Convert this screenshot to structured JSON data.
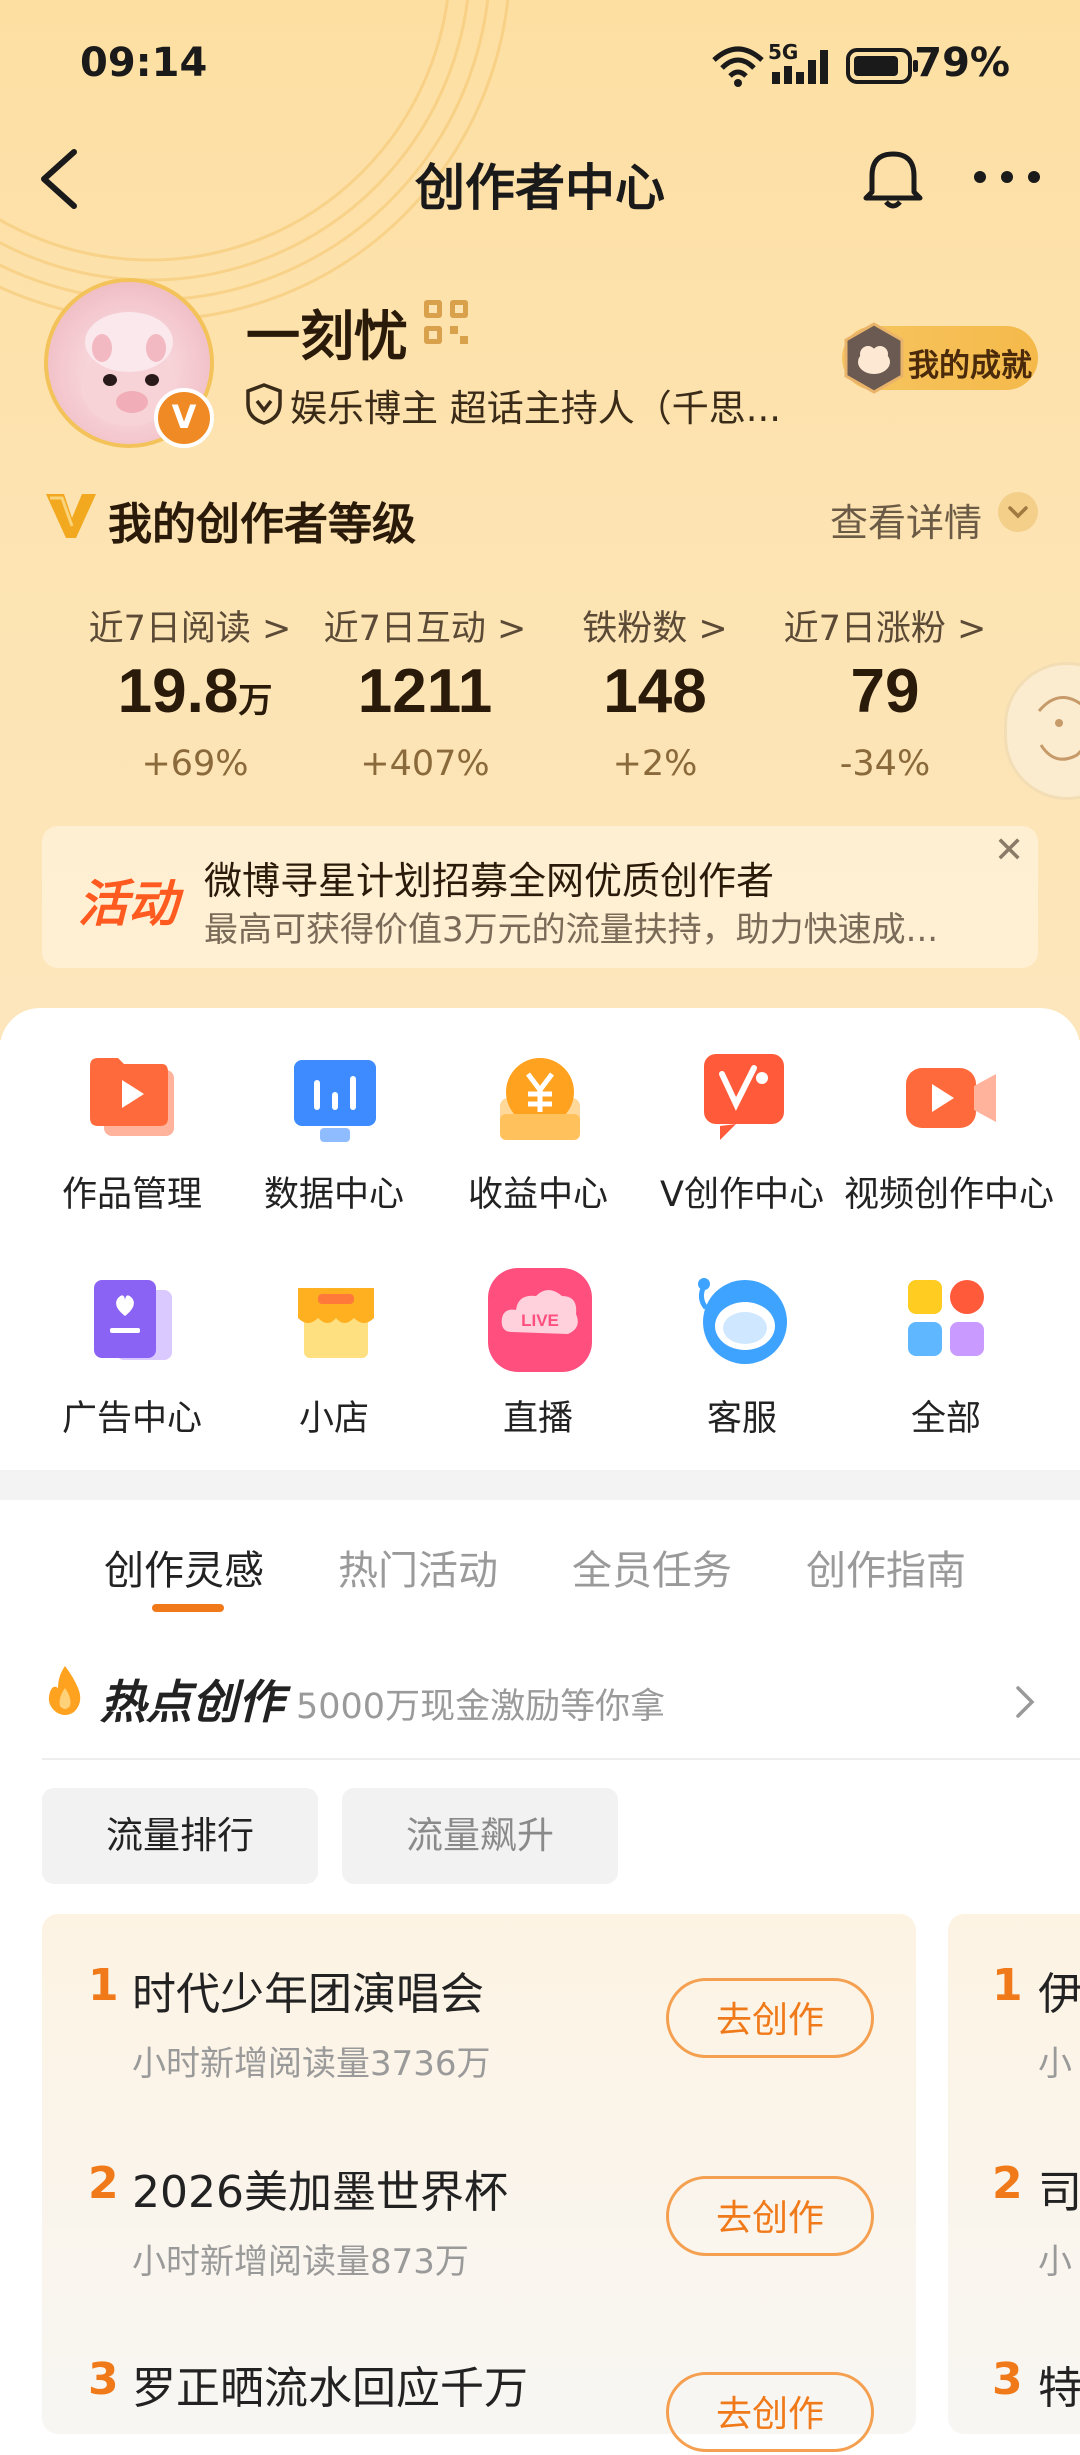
{
  "status_bar": {
    "time": "09:14",
    "network": "5G",
    "battery": "79%"
  },
  "nav": {
    "title": "创作者中心"
  },
  "profile": {
    "name": "一刻忧",
    "verification": "娱乐博主 超话主持人（千思...",
    "achievement_label": "我的成就"
  },
  "level": {
    "title": "我的创作者等级",
    "view_detail": "查看详情"
  },
  "stats": [
    {
      "label": "近7日阅读 >",
      "value": "19.8",
      "unit": "万",
      "change": "+69%"
    },
    {
      "label": "近7日互动 >",
      "value": "1211",
      "unit": "",
      "change": "+407%"
    },
    {
      "label": "铁粉数 >",
      "value": "148",
      "unit": "",
      "change": "+2%"
    },
    {
      "label": "近7日涨粉 >",
      "value": "79",
      "unit": "",
      "change": "-34%"
    }
  ],
  "promo": {
    "tag": "活动",
    "title": "微博寻星计划招募全网优质创作者",
    "desc": "最高可获得价值3万元的流量扶持，助力快速成..."
  },
  "tools": [
    {
      "label": "作品管理",
      "icon": "works-folder-icon",
      "color": "#ff6a3d"
    },
    {
      "label": "数据中心",
      "icon": "data-chart-icon",
      "color": "#3d8bff"
    },
    {
      "label": "收益中心",
      "icon": "yen-coin-icon",
      "color": "#ffa21f"
    },
    {
      "label": "V创作中心",
      "icon": "v-create-icon",
      "color": "#ff5a3a"
    },
    {
      "label": "视频创作中心",
      "icon": "video-camera-icon",
      "color": "#ff6a3d"
    },
    {
      "label": "广告中心",
      "icon": "ad-heart-icon",
      "color": "#8a63f5"
    },
    {
      "label": "小店",
      "icon": "shop-icon",
      "color": "#ffb020"
    },
    {
      "label": "直播",
      "icon": "live-icon",
      "color": "#ff4f7e"
    },
    {
      "label": "客服",
      "icon": "customer-service-icon",
      "color": "#3da3ff"
    },
    {
      "label": "全部",
      "icon": "all-apps-icon",
      "color": "#ff5a3a"
    }
  ],
  "tabs": [
    {
      "label": "创作灵感",
      "active": true
    },
    {
      "label": "热门活动",
      "active": false
    },
    {
      "label": "全员任务",
      "active": false
    },
    {
      "label": "创作指南",
      "active": false
    }
  ],
  "hot": {
    "title": "热点创作",
    "subtitle": "5000万现金激励等你拿"
  },
  "chips": [
    {
      "label": "流量排行",
      "active": true
    },
    {
      "label": "流量飙升",
      "active": false
    }
  ],
  "ranking": [
    {
      "rank": "1",
      "title": "时代少年团演唱会",
      "sub": "小时新增阅读量3736万",
      "button": "去创作"
    },
    {
      "rank": "2",
      "title": "2026美加墨世界杯",
      "sub": "小时新增阅读量873万",
      "button": "去创作"
    },
    {
      "rank": "3",
      "title": "罗正晒流水回应千万",
      "sub": "",
      "button": "去创作"
    }
  ],
  "ranking_peek": [
    {
      "rank": "1",
      "title": "伊",
      "sub": "小"
    },
    {
      "rank": "2",
      "title": "司",
      "sub": "小"
    },
    {
      "rank": "3",
      "title": "特",
      "sub": ""
    }
  ]
}
